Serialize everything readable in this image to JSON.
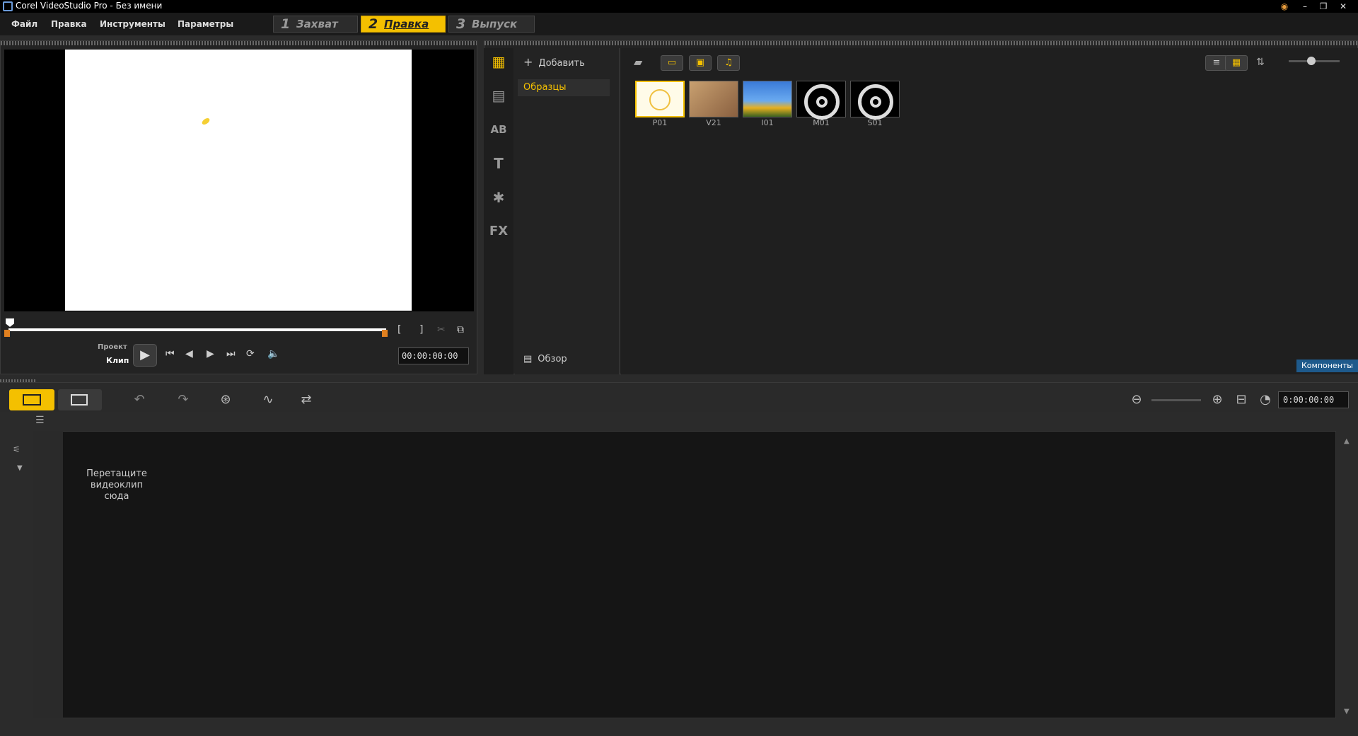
{
  "window": {
    "title": "Corel VideoStudio Pro - Без имени"
  },
  "menu": [
    "Файл",
    "Правка",
    "Инструменты",
    "Параметры"
  ],
  "steps": [
    {
      "num": "1",
      "label": "Захват"
    },
    {
      "num": "2",
      "label": "Правка"
    },
    {
      "num": "3",
      "label": "Выпуск"
    }
  ],
  "preview": {
    "mode_project": "Проект",
    "mode_clip": "Клип",
    "timecode": "00:00:00:00"
  },
  "library": {
    "add_label": "Добавить",
    "folder": "Образцы",
    "browse_label": "Обзор",
    "components_label": "Компоненты",
    "thumbs": [
      "P01",
      "V21",
      "I01",
      "M01",
      "S01"
    ]
  },
  "timeline": {
    "timecode": "0:00:00:00",
    "drop_hint": "Перетащите видеоклип сюда"
  }
}
